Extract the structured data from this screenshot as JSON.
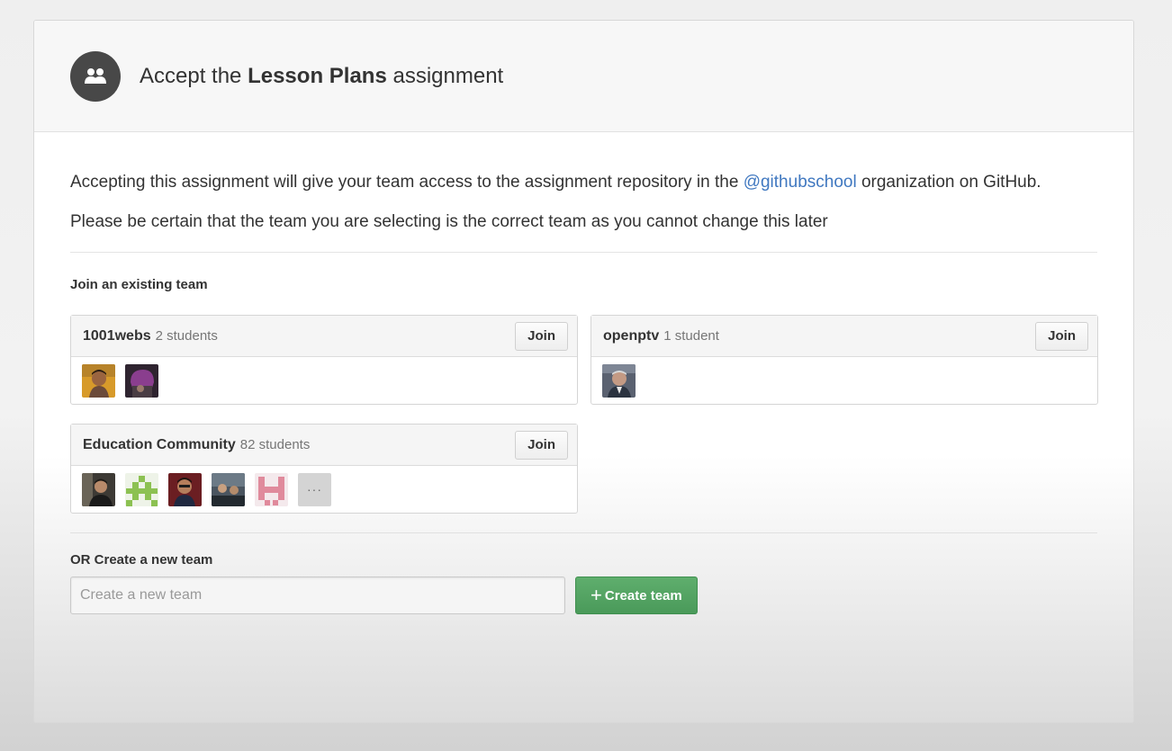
{
  "header": {
    "prefix": "Accept the ",
    "assignment_name": "Lesson Plans",
    "suffix": " assignment",
    "icon": "team-icon"
  },
  "intro": {
    "before": "Accepting this assignment will give your team access to the assignment repository in the ",
    "org_link": "@githubschool",
    "after": " organization on GitHub."
  },
  "warning": "Please be certain that the team you are selecting is the correct team as you cannot change this later",
  "join_section": {
    "label": "Join an existing team",
    "teams": [
      {
        "name": "1001webs",
        "count": "2 students",
        "join_label": "Join"
      },
      {
        "name": "openptv",
        "count": "1 student",
        "join_label": "Join"
      },
      {
        "name": "Education Community",
        "count": "82 students",
        "join_label": "Join",
        "more_label": "···"
      }
    ]
  },
  "create_section": {
    "label": "OR Create a new team",
    "input_placeholder": "Create a new team",
    "input_value": "",
    "button_label": "Create team",
    "button_icon": "plus-icon"
  },
  "colors": {
    "link": "#4078c0",
    "create_button": "#4fa05f",
    "header_icon_bg": "#484848"
  }
}
